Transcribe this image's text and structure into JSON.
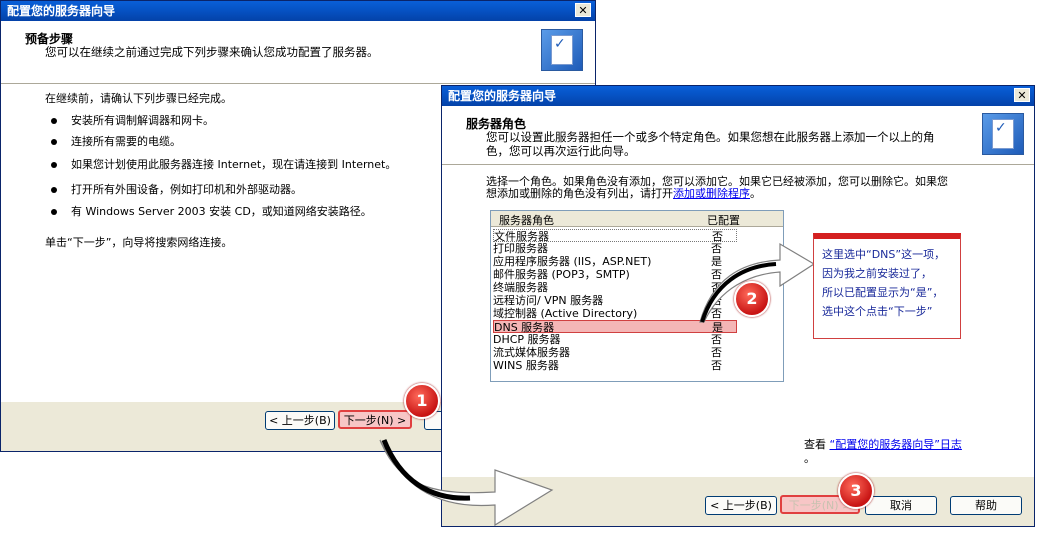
{
  "window1": {
    "title": "配置您的服务器向导",
    "close": "✕",
    "header_title": "预备步骤",
    "header_sub": "您可以在继续之前通过完成下列步骤来确认您成功配置了服务器。",
    "intro": "在继续前，请确认下列步骤已经完成。",
    "bullets": [
      "安装所有调制解调器和网卡。",
      "连接所有需要的电缆。",
      "如果您计划使用此服务器连接 Internet，现在请连接到 Internet。",
      "打开所有外围设备，例如打印机和外部驱动器。",
      "有 Windows Server 2003 安装 CD，或知道网络安装路径。"
    ],
    "footer_text": "单击“下一步”，向导将搜索网络连接。",
    "back_label": "< 上一步(B)",
    "next_label": "下一步(N) >"
  },
  "window2": {
    "title": "配置您的服务器向导",
    "close": "✕",
    "header_title": "服务器角色",
    "header_sub_1": "您可以设置此服务器担任一个或多个特定角色。如果您想在此服务器上添加一个以上的角",
    "header_sub_2": "色，您可以再次运行此向导。",
    "desc_1": "选择一个角色。如果角色没有添加，您可以添加它。如果它已经被添加，您可以删除它。如果您",
    "desc_2_prefix": "想添加或删除的角色没有列出，请打开",
    "desc_2_link": "添加或删除程序",
    "desc_2_suffix": "。",
    "list_col_role": "服务器角色",
    "list_col_status": "已配置",
    "roles": [
      {
        "name": "文件服务器",
        "status": "否"
      },
      {
        "name": "打印服务器",
        "status": "否"
      },
      {
        "name": "应用程序服务器 (IIS，ASP.NET)",
        "status": "是"
      },
      {
        "name": "邮件服务器 (POP3，SMTP)",
        "status": "否"
      },
      {
        "name": "终端服务器",
        "status": "否"
      },
      {
        "name": "远程访问/ VPN 服务器",
        "status": "否"
      },
      {
        "name": "域控制器 (Active Directory)",
        "status": "否"
      },
      {
        "name": "DNS 服务器",
        "status": "是"
      },
      {
        "name": "DHCP 服务器",
        "status": "否"
      },
      {
        "name": "流式媒体服务器",
        "status": "否"
      },
      {
        "name": "WINS 服务器",
        "status": "否"
      }
    ],
    "view_log_prefix": "查看",
    "view_log_link": "“配置您的服务器向导”日志",
    "view_log_suffix": "。",
    "back_label": "< 上一步(B)",
    "next_label": "下一步(N) >",
    "cancel_label": "取消",
    "help_label": "帮助"
  },
  "annotation": {
    "note_lines": [
      "这里选中“DNS”这一项，",
      "因为我之前安装过了，",
      "所以已配置显示为“是”，",
      "选中这个点击“下一步”"
    ],
    "badges": [
      "1",
      "2",
      "3"
    ]
  }
}
